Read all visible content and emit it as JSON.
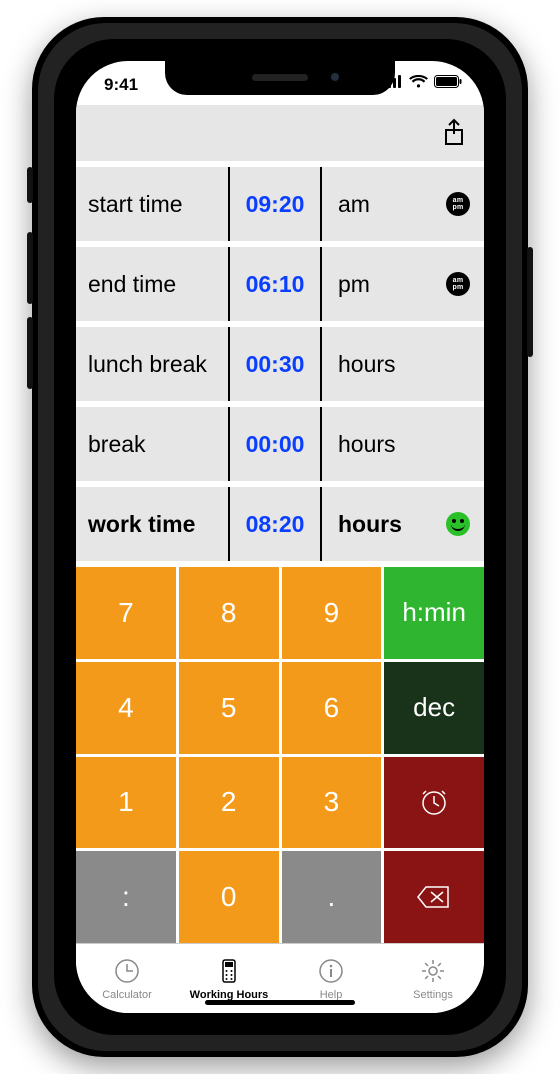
{
  "status": {
    "time": "9:41"
  },
  "rows": [
    {
      "label": "start time",
      "time": "09:20",
      "unit": "am",
      "badge": "ampm"
    },
    {
      "label": "end time",
      "time": "06:10",
      "unit": "pm",
      "badge": "ampm"
    },
    {
      "label": "lunch break",
      "time": "00:30",
      "unit": "hours",
      "badge": ""
    },
    {
      "label": "break",
      "time": "00:00",
      "unit": "hours",
      "badge": ""
    },
    {
      "label": "work time",
      "time": "08:20",
      "unit": "hours",
      "badge": "smiley"
    }
  ],
  "keypad": {
    "hmin": "h:min",
    "dec": "dec",
    "keys": {
      "k7": "7",
      "k8": "8",
      "k9": "9",
      "k4": "4",
      "k5": "5",
      "k6": "6",
      "k1": "1",
      "k2": "2",
      "k3": "3",
      "colon": ":",
      "k0": "0",
      "dot": "."
    }
  },
  "tabs": [
    {
      "id": "calculator",
      "label": "Calculator"
    },
    {
      "id": "working-hours",
      "label": "Working Hours"
    },
    {
      "id": "help",
      "label": "Help"
    },
    {
      "id": "settings",
      "label": "Settings"
    }
  ],
  "tabs_selected": "working-hours"
}
